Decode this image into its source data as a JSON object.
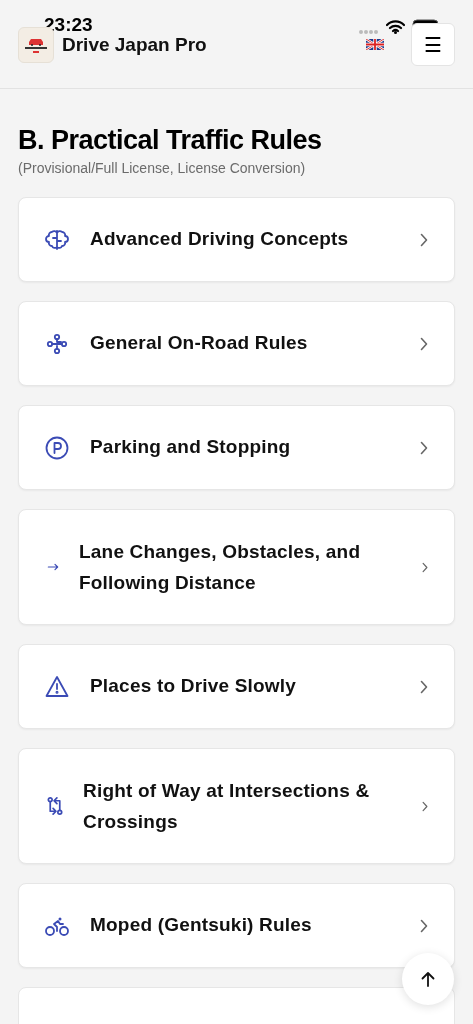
{
  "status_bar": {
    "time": "23:23"
  },
  "header": {
    "title": "Drive Japan Pro",
    "menu_button": "☰"
  },
  "section": {
    "title": "B. Practical Traffic Rules",
    "subtitle": "(Provisional/Full License, License Conversion)"
  },
  "topics": [
    {
      "label": "Advanced Driving Concepts"
    },
    {
      "label": "General On-Road Rules"
    },
    {
      "label": "Parking and Stopping"
    },
    {
      "label": "Lane Changes, Obstacles, and Following Distance"
    },
    {
      "label": "Places to Drive Slowly"
    },
    {
      "label": "Right of Way at Intersections & Crossings"
    },
    {
      "label": "Moped (Gentsuki) Rules"
    }
  ]
}
